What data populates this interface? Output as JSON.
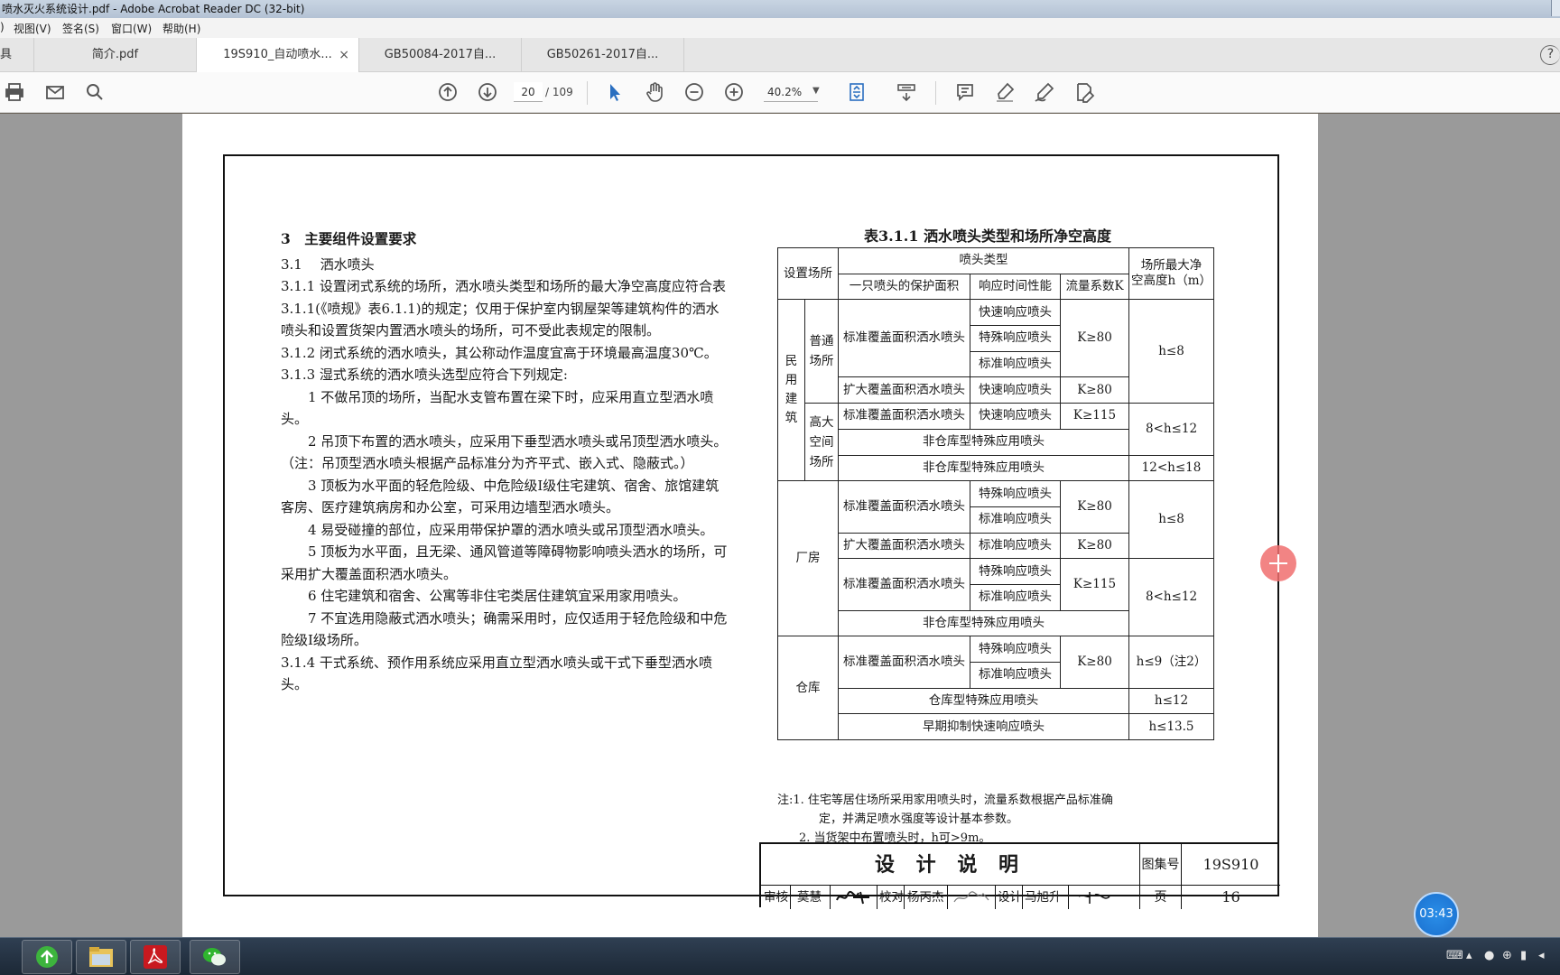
{
  "window": {
    "title": "喷水灭火系统设计.pdf - Adobe Acrobat Reader DC (32-bit)"
  },
  "menu": {
    "cut_item": ")",
    "view": "视图(V)",
    "sign": "签名(S)",
    "window": "窗口(W)",
    "help": "帮助(H)"
  },
  "tabs": [
    {
      "label": "具"
    },
    {
      "label": "简介.pdf"
    },
    {
      "label": "19S910_自动喷水...",
      "close": "×"
    },
    {
      "label": "GB50084-2017自..."
    },
    {
      "label": "GB50261-2017自..."
    }
  ],
  "toolbar": {
    "current_page": "20",
    "page_total": "/ 109",
    "zoom": "40.2%",
    "help_symbol": "?"
  },
  "document": {
    "section_heading": "3　主要组件设置要求",
    "left_paragraphs": [
      "3.1　 洒水喷头",
      "3.1.1 设置闭式系统的场所，洒水喷头类型和场所的最大净空高度应符合表3.1.1(《喷规》表6.1.1)的规定；仅用于保护室内钢屋架等建筑构件的洒水喷头和设置货架内置洒水喷头的场所，可不受此表规定的限制。",
      "3.1.2 闭式系统的洒水喷头，其公称动作温度宜高于环境最高温度30℃。",
      "3.1.3 湿式系统的洒水喷头选型应符合下列规定:",
      "1 不做吊顶的场所，当配水支管布置在梁下时，应采用直立型洒水喷头。",
      "2 吊顶下布置的洒水喷头，应采用下垂型洒水喷头或吊顶型洒水喷头。（注：吊顶型洒水喷头根据产品标准分为齐平式、嵌入式、隐蔽式。）",
      "3 顶板为水平面的轻危险级、中危险级Ⅰ级住宅建筑、宿舍、旅馆建筑客房、医疗建筑病房和办公室，可采用边墙型洒水喷头。",
      "4 易受碰撞的部位，应采用带保护罩的洒水喷头或吊顶型洒水喷头。",
      "5 顶板为水平面，且无梁、通风管道等障碍物影响喷头洒水的场所，可采用扩大覆盖面积洒水喷头。",
      "6 住宅建筑和宿舍、公寓等非住宅类居住建筑宜采用家用喷头。",
      "7 不宜选用隐蔽式洒水喷头；确需采用时，应仅适用于轻危险级和中危险级Ⅰ级场所。",
      "3.1.4 干式系统、预作用系统应采用直立型洒水喷头或干式下垂型洒水喷头。"
    ],
    "table_title": "表3.1.1 洒水喷头类型和场所净空高度",
    "table": {
      "h_place": "设置场所",
      "h_type": "喷头类型",
      "h_maxh_1": "场所最大净",
      "h_maxh_2": "空高度h（m）",
      "h_area": "一只喷头的保护面积",
      "h_resp": "响应时间性能",
      "h_k": "流量系数K",
      "civil": "民用建筑",
      "ordinary": "普通场所",
      "tall": "高大空间场所",
      "factory": "厂房",
      "warehouse": "仓库",
      "std_cover": "标准覆盖面积洒水喷头",
      "ext_cover": "扩大覆盖面积洒水喷头",
      "fast": "快速响应喷头",
      "special": "特殊响应喷头",
      "standard": "标准响应喷头",
      "k80": "K≥80",
      "k115": "K≥115",
      "h8": "h≤8",
      "h8_12": "8<h≤12",
      "h12_18": "12<h≤18",
      "h9": "h≤9（注2）",
      "h12": "h≤12",
      "h135": "h≤13.5",
      "non_wh_special": "非仓库型特殊应用喷头",
      "wh_special": "仓库型特殊应用喷头",
      "esfr": "早期抑制快速响应喷头"
    },
    "notes": {
      "n1a": "注:1. 住宅等居住场所采用家用喷头时，流量系数根据产品标准确",
      "n1b": "定，并满足喷水强度等设计基本参数。",
      "n2": "2. 当货架中布置喷头时，h可>9m。"
    },
    "title_block": {
      "name": "设 计 说 明",
      "atlas_label": "图集号",
      "atlas_no": "19S910",
      "review": "审核",
      "reviewer": "莫慧",
      "check": "校对",
      "checker": "杨丙杰",
      "design": "设计",
      "designer": "马旭升",
      "page_label": "页",
      "page_no": "16"
    }
  },
  "overlay": {
    "timer": "03:43"
  },
  "colors": {
    "accent_marker": "#f06e6e",
    "timer": "#1a6fce"
  }
}
